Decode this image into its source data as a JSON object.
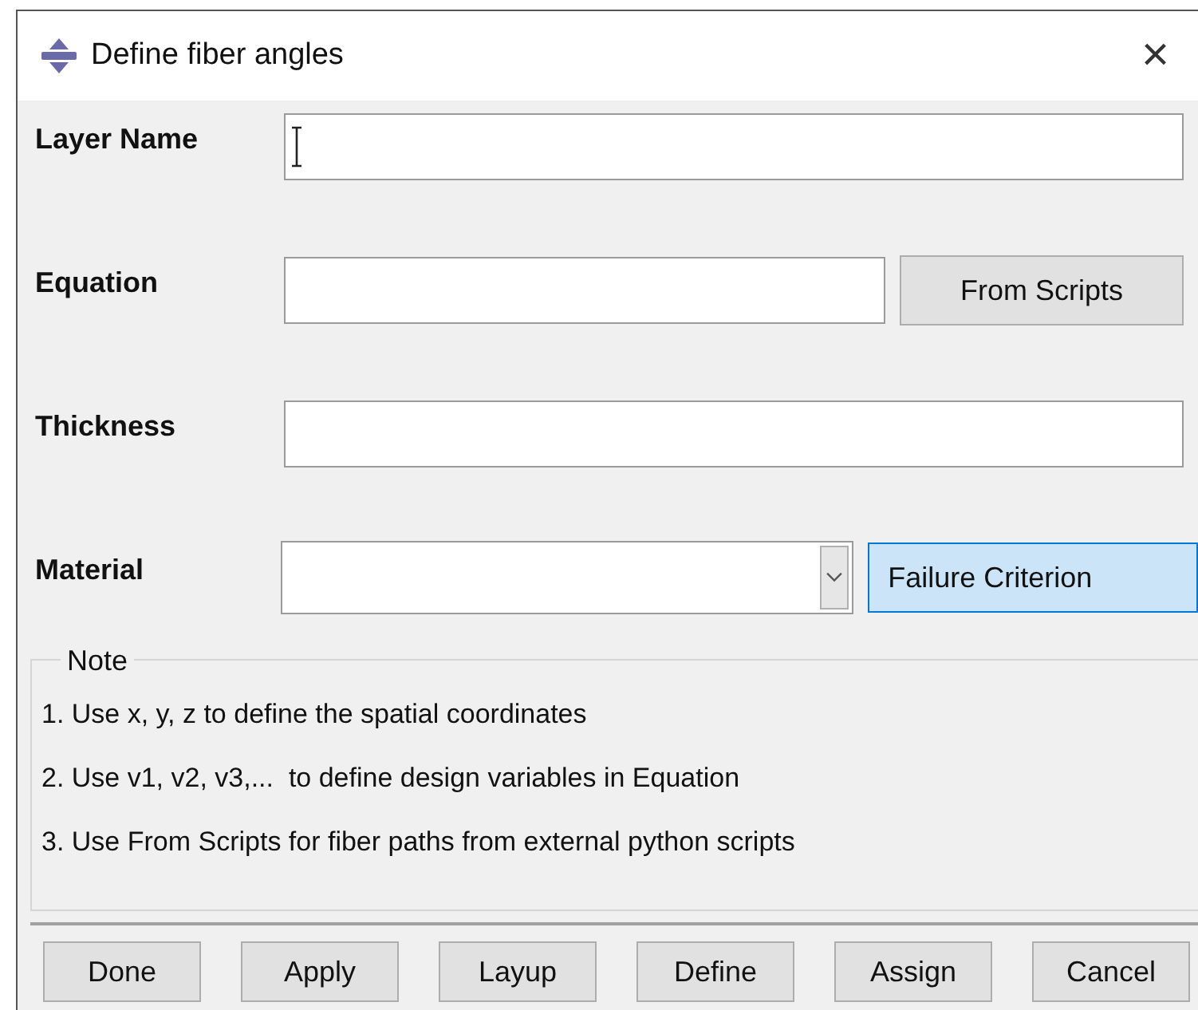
{
  "window": {
    "title": "Define fiber angles",
    "close": "×"
  },
  "fields": [
    {
      "label": "Layer Name",
      "kind": "text"
    },
    {
      "label": "Equation",
      "kind": "text",
      "button": {
        "label": "From Scripts",
        "default": false
      }
    },
    {
      "label": "Thickness",
      "kind": "text"
    },
    {
      "label": "Material",
      "kind": "combo",
      "button": {
        "label": "Failure Criterion",
        "default": true
      }
    }
  ],
  "note": {
    "title": "Note",
    "lines": [
      "1. Use x, y, z to define the spatial coordinates",
      "2. Use v1, v2, v3,...  to define design variables in Equation",
      "3. Use From Scripts for fiber paths from external python scripts"
    ]
  },
  "buttons": [
    {
      "label": "Done",
      "default": false
    },
    {
      "label": "Apply",
      "default": false
    },
    {
      "label": "Layup",
      "default": false
    },
    {
      "label": "Define",
      "default": false
    },
    {
      "label": "Assign",
      "default": false
    },
    {
      "label": "Cancel",
      "default": false
    }
  ]
}
